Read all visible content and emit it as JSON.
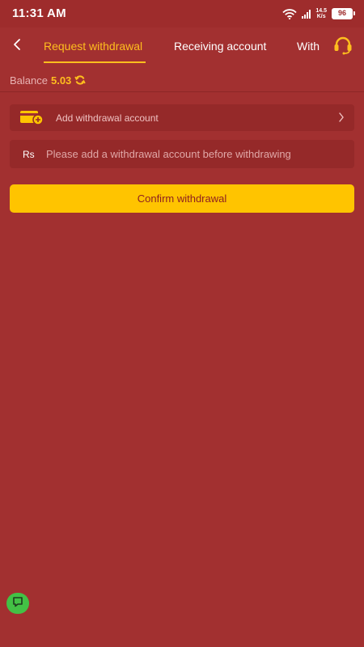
{
  "status_bar": {
    "time": "11:31 AM",
    "net_speed_value": "14.5",
    "net_speed_unit": "K/s",
    "battery": "96"
  },
  "nav": {
    "back_icon": "chevron-left-icon",
    "tabs": [
      {
        "label": "Request withdrawal",
        "active": true
      },
      {
        "label": "Receiving account",
        "active": false
      },
      {
        "label": "With",
        "active": false
      }
    ],
    "support_icon": "headset-icon"
  },
  "balance": {
    "label": "Balance",
    "value": "5.03",
    "refresh_icon": "refresh-icon"
  },
  "add_account": {
    "icon": "wallet-add-icon",
    "label": "Add withdrawal account",
    "chevron_icon": "chevron-right-icon"
  },
  "amount_field": {
    "currency": "Rs",
    "placeholder": "Please add a withdrawal account before withdrawing",
    "value": ""
  },
  "confirm_button": {
    "label": "Confirm withdrawal"
  },
  "chat_fab": {
    "icon": "chat-icon"
  },
  "colors": {
    "background": "#a23030",
    "accent": "#ffbe1e",
    "button": "#ffc400",
    "card": "#952929",
    "chat": "#43c145"
  }
}
